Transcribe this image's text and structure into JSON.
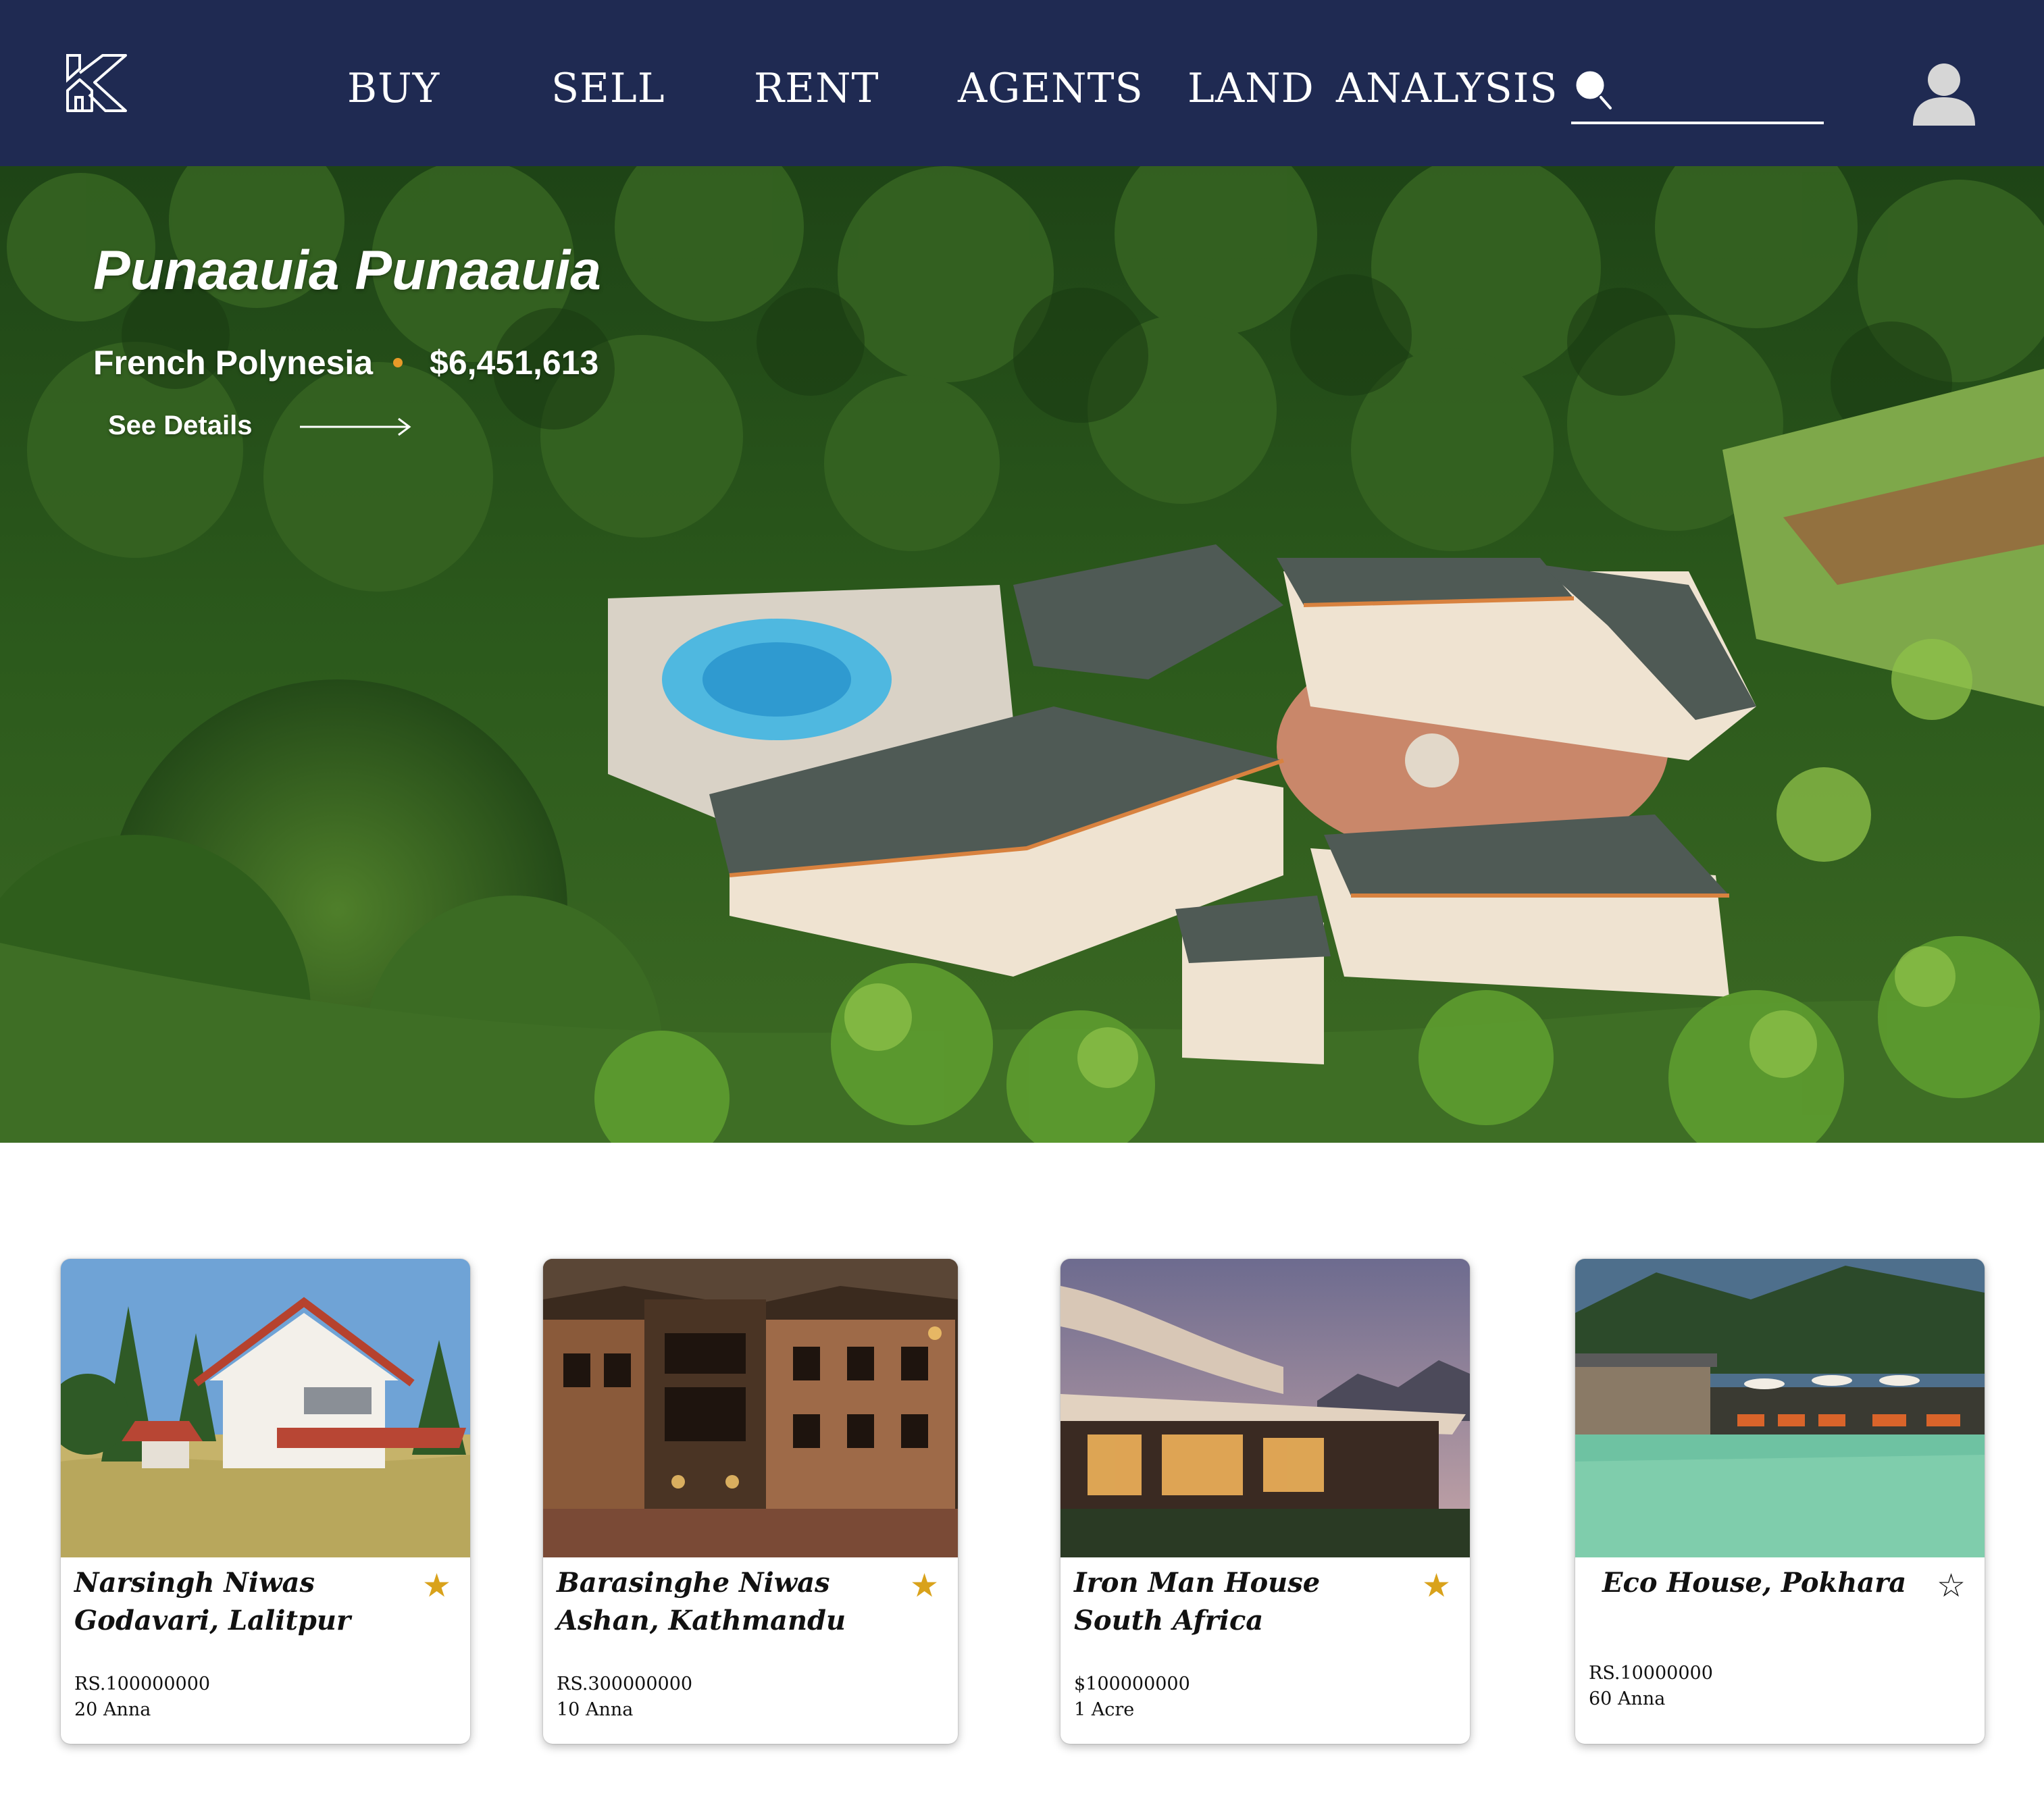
{
  "nav": {
    "logo_icon": "k-house-logo-icon",
    "items": [
      {
        "label": "BUY"
      },
      {
        "label": "SELL"
      },
      {
        "label": "RENT"
      },
      {
        "label": "AGENTS"
      },
      {
        "label": "LAND  ANALYSIS"
      }
    ],
    "search": {
      "placeholder": "",
      "icon": "search-icon"
    },
    "user_icon": "user-icon",
    "colors": {
      "bar": "#1f2a52",
      "text": "#ffffff"
    }
  },
  "hero": {
    "title": "Punaauia Punaauia",
    "location": "French Polynesia",
    "price": "$6,451,613",
    "cta": "See Details",
    "cta_icon": "arrow-right-icon",
    "dot_color": "#e89a28"
  },
  "listings": [
    {
      "name_line1": "Narsingh Niwas",
      "name_line2": "Godavari, Lalitpur",
      "price": "RS.100000000",
      "area": "20 Anna",
      "star": "★",
      "starred": true
    },
    {
      "name_line1": "Barasinghe Niwas",
      "name_line2": "Ashan, Kathmandu",
      "price": "RS.300000000",
      "area": "10 Anna",
      "star": "★",
      "starred": true
    },
    {
      "name_line1": "Iron Man House",
      "name_line2": "South Africa",
      "price": "$100000000",
      "area": "1 Acre",
      "star": "★",
      "starred": true
    },
    {
      "name_line1": "Eco House, Pokhara",
      "name_line2": "",
      "price": "RS.10000000",
      "area": "60 Anna",
      "star": "☆",
      "starred": false
    }
  ],
  "star_color": "#d9a21b"
}
